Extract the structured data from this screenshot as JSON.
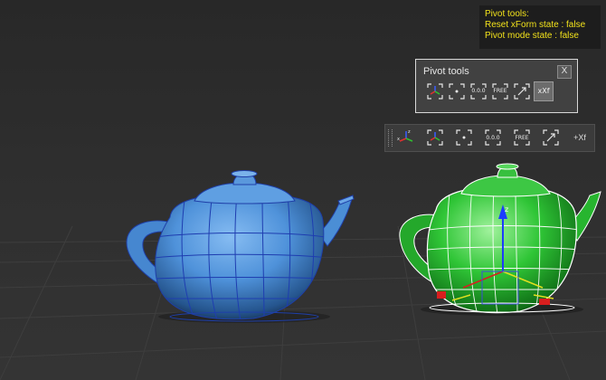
{
  "colors": {
    "viewport_bg": "#2e2e2e",
    "grid_line": "#3c3c3c",
    "status_text": "#f2e21b",
    "teapot_blue": "#4a8fd8",
    "teapot_green": "#22b02a",
    "selection_white": "#ffffff",
    "gizmo_blue": "#1b3fe0"
  },
  "status_overlay": {
    "line1": "Pivot tools:",
    "line2": "Reset xForm state : false",
    "line3": "Pivot mode state : false"
  },
  "pivot_panel": {
    "title": "Pivot tools",
    "close_label": "X",
    "tools": [
      {
        "name": "align-pivot-icon",
        "label": ""
      },
      {
        "name": "center-pivot-icon",
        "label": ""
      },
      {
        "name": "zero-pivot-icon",
        "label": "0.0.0"
      },
      {
        "name": "free-pivot-icon",
        "label": "FREE"
      },
      {
        "name": "scale-pivot-icon",
        "label": ""
      },
      {
        "name": "reset-xform-icon",
        "label": "xXf"
      }
    ]
  },
  "dock_toolbar": {
    "tools": [
      {
        "name": "xyz-axis-icon",
        "label": ""
      },
      {
        "name": "align-pivot-icon",
        "label": ""
      },
      {
        "name": "center-pivot-icon",
        "label": ""
      },
      {
        "name": "zero-pivot-icon",
        "label": "0.0.0"
      },
      {
        "name": "free-pivot-icon",
        "label": "FREE"
      },
      {
        "name": "scale-pivot-icon",
        "label": ""
      },
      {
        "name": "reset-xform-icon",
        "label": "+Xf"
      }
    ]
  },
  "scene": {
    "objects": [
      {
        "name": "blue-teapot",
        "color": "#4a8fd8",
        "selected": false
      },
      {
        "name": "green-teapot",
        "color": "#22b02a",
        "selected": true
      }
    ],
    "gizmo_axis_label": "z"
  }
}
